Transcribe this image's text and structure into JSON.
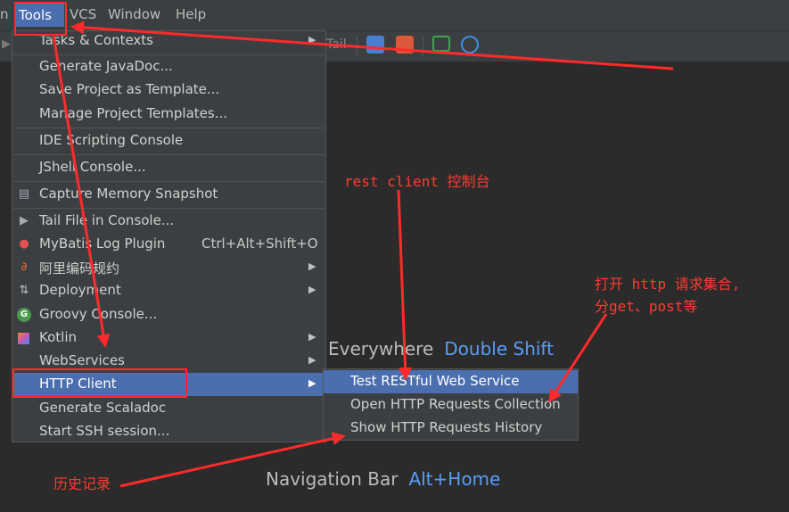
{
  "menubar": {
    "items": [
      {
        "label": "n"
      },
      {
        "label": "Tools"
      },
      {
        "label": "VCS"
      },
      {
        "label": "Window"
      },
      {
        "label": "Help"
      }
    ]
  },
  "toolbar": {
    "tail_label": "Tail"
  },
  "tools_menu": {
    "items": [
      {
        "label": "Tasks & Contexts",
        "submenu": true
      },
      {
        "label": "Generate JavaDoc..."
      },
      {
        "label": "Save Project as Template..."
      },
      {
        "label": "Manage Project Templates..."
      },
      {
        "label": "IDE Scripting Console"
      },
      {
        "label": "JShell Console..."
      },
      {
        "label": "Capture Memory Snapshot"
      },
      {
        "label": "Tail File in Console..."
      },
      {
        "label": "MyBatis Log Plugin",
        "shortcut": "Ctrl+Alt+Shift+O"
      },
      {
        "label": "阿里编码规约",
        "submenu": true
      },
      {
        "label": "Deployment",
        "submenu": true
      },
      {
        "label": "Groovy Console..."
      },
      {
        "label": "Kotlin",
        "submenu": true
      },
      {
        "label": "WebServices",
        "submenu": true
      },
      {
        "label": "HTTP Client",
        "submenu": true,
        "selected": true
      },
      {
        "label": "Generate Scaladoc"
      },
      {
        "label": "Start SSH session..."
      }
    ]
  },
  "http_client_submenu": {
    "items": [
      {
        "label": "Test RESTful Web Service",
        "selected": true
      },
      {
        "label": "Open HTTP Requests Collection"
      },
      {
        "label": "Show HTTP Requests History"
      }
    ]
  },
  "hints": {
    "search_everywhere": {
      "text": "Everywhere",
      "key": "Double Shift"
    },
    "navigation_bar": {
      "text": "Navigation Bar",
      "key": "Alt+Home"
    }
  },
  "annotations": {
    "rest_client": "rest client 控制台",
    "http_collection_line1": "打开 http 请求集合,",
    "http_collection_line2": "分get、post等",
    "history": "历史记录"
  },
  "colors": {
    "selection": "#4b6eaf",
    "annotation": "#ff2a2a",
    "shortcut_key": "#589df6"
  }
}
